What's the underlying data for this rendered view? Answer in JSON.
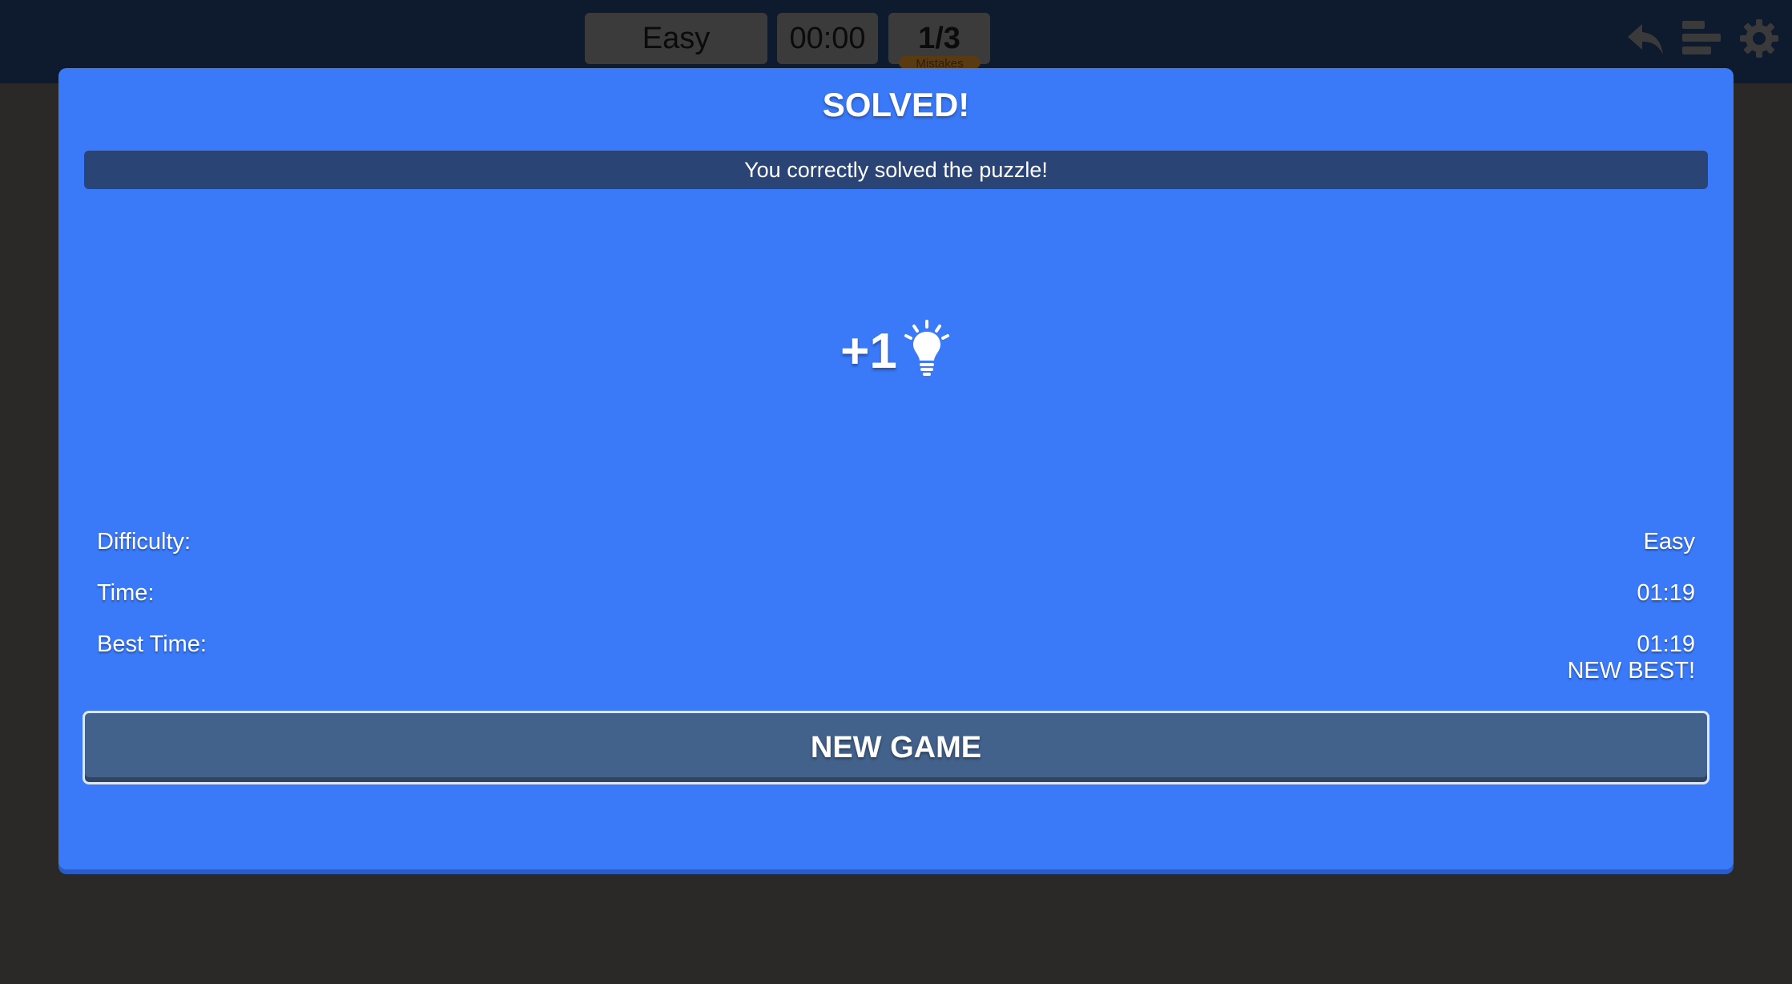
{
  "header": {
    "difficulty": "Easy",
    "timer": "00:00",
    "mistakes": "1/3",
    "mistakes_caption": "Mistakes",
    "icons": [
      "undo-icon",
      "stats-icon",
      "settings-icon"
    ]
  },
  "modal": {
    "title": "SOLVED!",
    "message": "You correctly solved the puzzle!",
    "reward": "+1",
    "reward_icon": "lightbulb-icon",
    "stats": {
      "difficulty_label": "Difficulty:",
      "difficulty_value": "Easy",
      "time_label": "Time:",
      "time_value": "01:19",
      "best_label": "Best Time:",
      "best_value": "01:19",
      "new_best": "NEW BEST!"
    },
    "button_label": "NEW GAME"
  },
  "colors": {
    "topbar": "#0e1a2e",
    "modal": "#3a79f7",
    "banner": "#2a4575",
    "button": "#42618b",
    "backdrop": "#2a2928"
  }
}
